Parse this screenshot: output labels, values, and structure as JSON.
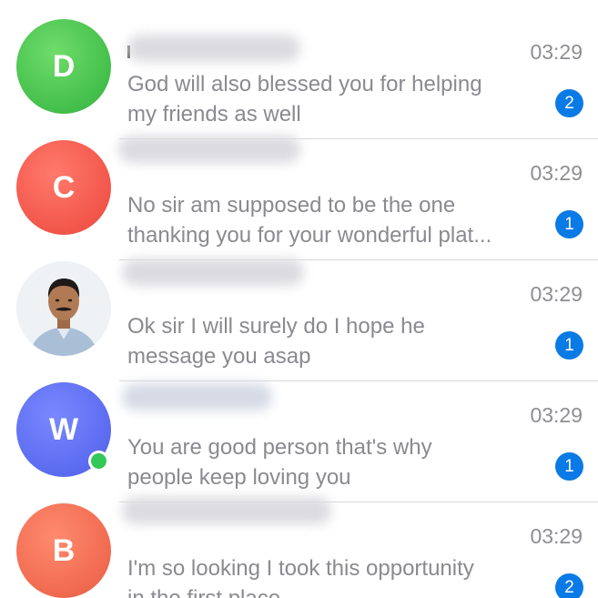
{
  "chats": [
    {
      "avatar_letter": "D",
      "avatar_color": "#4cc552",
      "time": "03:29",
      "message_line1": "God will also blessed you for helping",
      "message_line2": "my friends as well",
      "unread": "2"
    },
    {
      "avatar_letter": "C",
      "avatar_color": "#f2564a",
      "time": "03:29",
      "message_line1": "No sir am supposed to be the one",
      "message_line2": "thanking you for your wonderful plat...",
      "unread": "1"
    },
    {
      "avatar_letter": "",
      "avatar_color": "#e9eef3",
      "time": "03:29",
      "message_line1": "Ok sir I will surely do I hope he",
      "message_line2": "message you asap",
      "unread": "1"
    },
    {
      "avatar_letter": "W",
      "avatar_color": "#5b6bef",
      "online": true,
      "time": "03:29",
      "message_line1": "You are good person that's why",
      "message_line2": "people keep loving you",
      "unread": "1"
    },
    {
      "avatar_letter": "B",
      "avatar_color": "#f06a50",
      "time": "03:29",
      "message_line1": "I'm so looking I took this opportunity",
      "message_line2": "in the first place",
      "unread": "2"
    }
  ],
  "colors": {
    "badge": "#0a7ae6",
    "online_indicator": "#34c759",
    "message_text": "#8a8a8f",
    "time_text": "#8e8e93",
    "separator": "#d9d9de"
  }
}
